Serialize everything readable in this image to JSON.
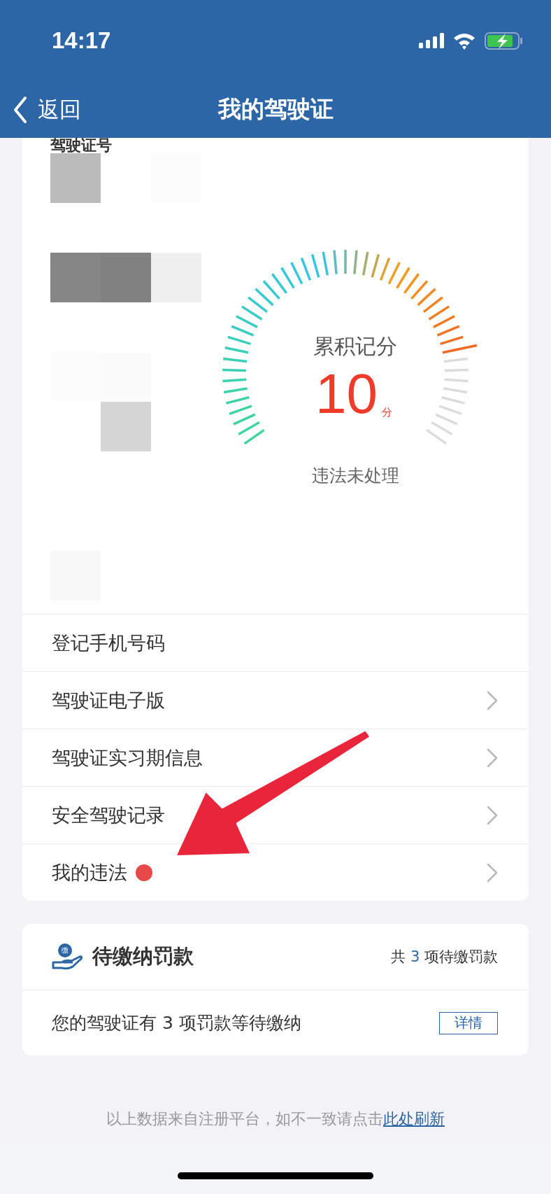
{
  "status_bar": {
    "time": "14:17"
  },
  "nav_bar": {
    "back_label": "返回",
    "title": "我的驾驶证"
  },
  "license_card": {
    "number_label": "驾驶证号",
    "gauge": {
      "title": "累积记分",
      "score": "10",
      "unit": "分",
      "status": "违法未处理"
    }
  },
  "menu_items": [
    {
      "label": "登记手机号码",
      "chevron": false,
      "badge": false
    },
    {
      "label": "驾驶证电子版",
      "chevron": true,
      "badge": false
    },
    {
      "label": "驾驶证实习期信息",
      "chevron": true,
      "badge": false
    },
    {
      "label": "安全驾驶记录",
      "chevron": true,
      "badge": false
    },
    {
      "label": "我的违法",
      "chevron": true,
      "badge": true
    }
  ],
  "fines": {
    "icon_text": "缴",
    "title": "待缴纳罚款",
    "summary_prefix": "共",
    "summary_count": "3",
    "summary_suffix": "项待缴罚款",
    "message": "您的驾驶证有 3 项罚款等待缴纳",
    "details_button": "详情"
  },
  "footer": {
    "text": "以上数据来自注册平台，如不一致请点击",
    "link": "此处刷新"
  }
}
